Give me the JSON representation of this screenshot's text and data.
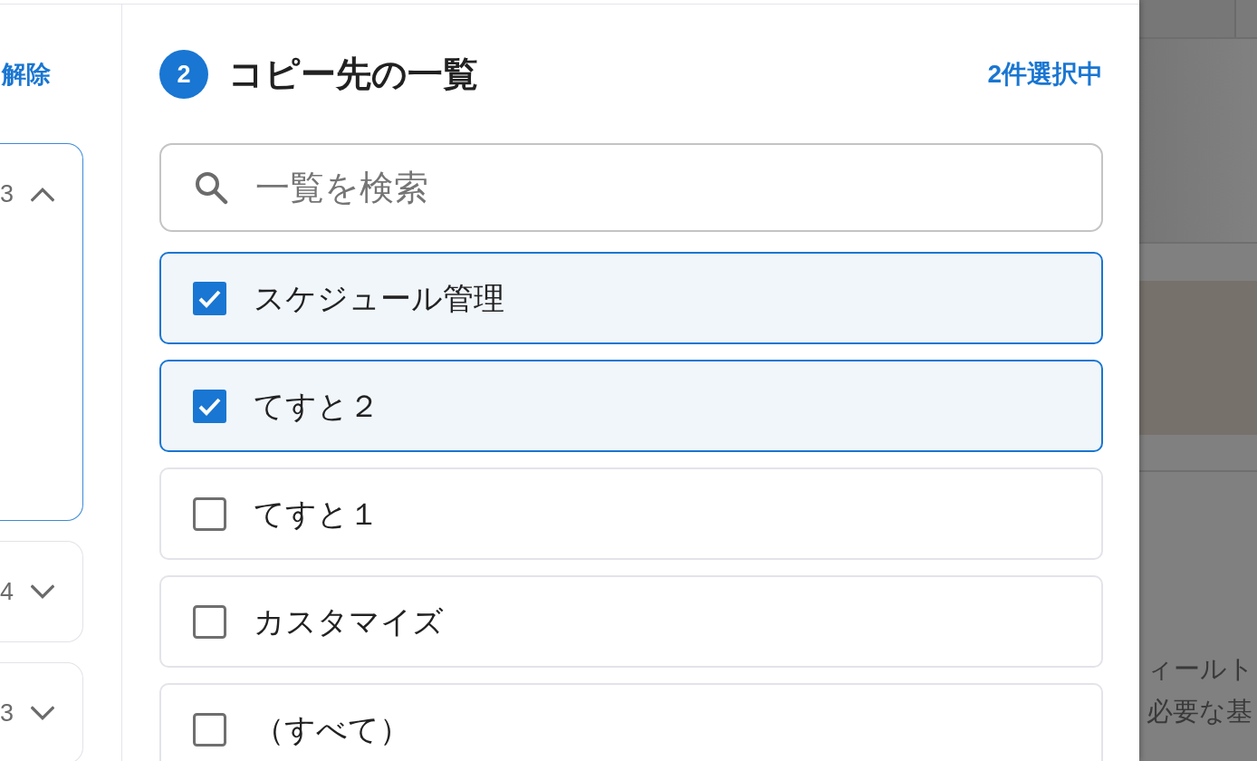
{
  "left_panel": {
    "clear_link": "解除",
    "groups": [
      {
        "count": "3",
        "expanded": true
      },
      {
        "count": "4",
        "expanded": false
      },
      {
        "count": "3",
        "expanded": false
      }
    ]
  },
  "destination_panel": {
    "step": "2",
    "title": "コピー先の一覧",
    "selection_count": "2件選択中",
    "search": {
      "placeholder": "一覧を検索"
    },
    "items": [
      {
        "label": "スケジュール管理",
        "checked": true
      },
      {
        "label": "てすと２",
        "checked": true
      },
      {
        "label": "てすと１",
        "checked": false
      },
      {
        "label": "カスタマイズ",
        "checked": false
      },
      {
        "label": "（すべて）",
        "checked": false
      }
    ]
  },
  "background_page": {
    "lines": [
      "ィールト",
      "必要な基"
    ]
  }
}
